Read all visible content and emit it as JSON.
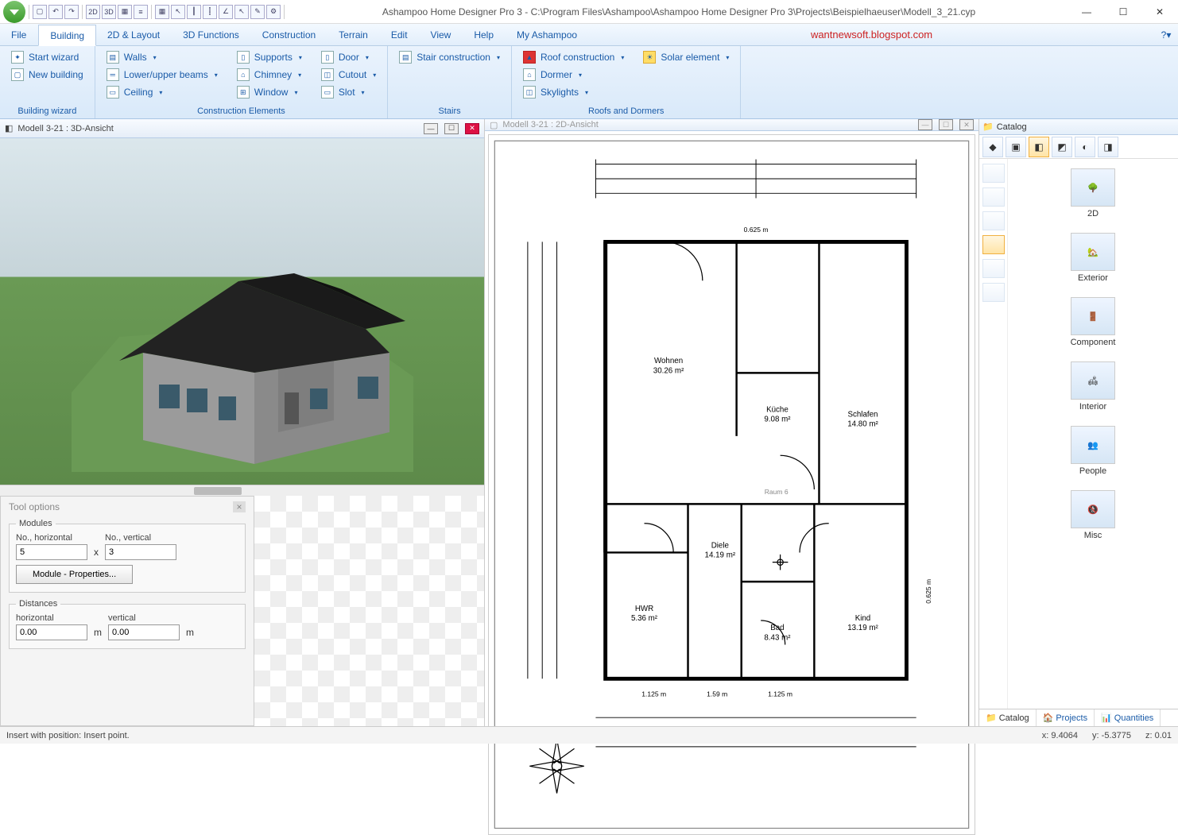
{
  "titlebar": {
    "title": "Ashampoo Home Designer Pro 3 - C:\\Program Files\\Ashampoo\\Ashampoo Home Designer Pro 3\\Projects\\Beispielhaeuser\\Modell_3_21.cyp",
    "qat_icons": [
      "new",
      "undo",
      "redo",
      "sep",
      "2D",
      "3D",
      "grid",
      "list",
      "sep",
      "snap",
      "pointer",
      "ruler",
      "ruler2",
      "angle",
      "pointer2",
      "paint",
      "settings",
      "sep"
    ]
  },
  "menu": {
    "tabs": [
      "File",
      "Building",
      "2D & Layout",
      "3D Functions",
      "Construction",
      "Terrain",
      "Edit",
      "View",
      "Help",
      "My Ashampoo"
    ],
    "active": "Building",
    "watermark": "wantnewsoft.blogspot.com",
    "help_icon": "?"
  },
  "ribbon": {
    "groups": [
      {
        "title": "Building wizard",
        "cols": [
          [
            {
              "icon": "wand",
              "label": "Start wizard",
              "dd": false
            },
            {
              "icon": "doc",
              "label": "New building",
              "dd": false
            }
          ]
        ]
      },
      {
        "title": "Construction Elements",
        "cols": [
          [
            {
              "icon": "wall",
              "label": "Walls",
              "dd": true
            },
            {
              "icon": "beam",
              "label": "Lower/upper beams",
              "dd": true
            },
            {
              "icon": "ceil",
              "label": "Ceiling",
              "dd": true
            }
          ],
          [
            {
              "icon": "col",
              "label": "Supports",
              "dd": true
            },
            {
              "icon": "chim",
              "label": "Chimney",
              "dd": true
            },
            {
              "icon": "win",
              "label": "Window",
              "dd": true
            }
          ],
          [
            {
              "icon": "door",
              "label": "Door",
              "dd": true
            },
            {
              "icon": "cut",
              "label": "Cutout",
              "dd": true
            },
            {
              "icon": "slot",
              "label": "Slot",
              "dd": true
            }
          ]
        ]
      },
      {
        "title": "Stairs",
        "cols": [
          [
            {
              "icon": "stair",
              "label": "Stair construction",
              "dd": true
            }
          ]
        ]
      },
      {
        "title": "Roofs and Dormers",
        "cols": [
          [
            {
              "icon": "roof",
              "label": "Roof construction",
              "dd": true
            },
            {
              "icon": "dorm",
              "label": "Dormer",
              "dd": true
            },
            {
              "icon": "sky",
              "label": "Skylights",
              "dd": true
            }
          ],
          [
            {
              "icon": "solar",
              "label": "Solar element",
              "dd": true
            }
          ]
        ]
      }
    ]
  },
  "views": {
    "left_title": "Modell 3-21 : 3D-Ansicht",
    "right_title": "Modell 3-21 : 2D-Ansicht"
  },
  "floorplan": {
    "overall_width": "0.625 m",
    "rooms": [
      {
        "name": "Wohnen",
        "area": "30.26 m²"
      },
      {
        "name": "Küche",
        "area": "9.08 m²"
      },
      {
        "name": "Schlafen",
        "area": "14.80 m²"
      },
      {
        "name": "Diele",
        "area": "14.19 m²"
      },
      {
        "name": "HWR",
        "area": "5.36 m²"
      },
      {
        "name": "Bad",
        "area": "8.43 m²"
      },
      {
        "name": "Kind",
        "area": "13.19 m²"
      }
    ],
    "dims_bottom": [
      "1.125 m",
      "1.59 m",
      "1.125 m"
    ],
    "dim_right": "0.625 m",
    "raum_label": "Raum 6",
    "wind_rose": true
  },
  "tool_options": {
    "title": "Tool options",
    "modules_legend": "Modules",
    "no_horizontal_label": "No., horizontal",
    "no_vertical_label": "No., vertical",
    "no_horizontal": "5",
    "no_vertical": "3",
    "x": "x",
    "module_props_btn": "Module - Properties...",
    "distances_legend": "Distances",
    "horizontal_label": "horizontal",
    "vertical_label": "vertical",
    "horizontal": "0.00",
    "vertical": "0.00",
    "unit": "m"
  },
  "catalog": {
    "header": "Catalog",
    "items": [
      "2D",
      "Exterior",
      "Component",
      "Interior",
      "People",
      "Misc"
    ],
    "tabs": [
      {
        "label": "Catalog",
        "active": true
      },
      {
        "label": "Projects",
        "active": false
      },
      {
        "label": "Quantities",
        "active": false
      }
    ]
  },
  "status": {
    "message": "Insert with position: Insert point.",
    "x": "x: 9.4064",
    "y": "y: -5.3775",
    "z": "z: 0.01"
  }
}
